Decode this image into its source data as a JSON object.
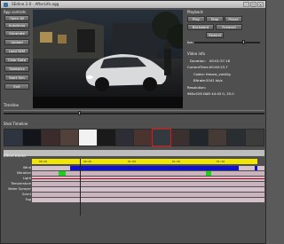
{
  "window": {
    "title": "SEdine 2.0 - AfterLife.ogg",
    "buttons": [
      "–",
      "□",
      "✕"
    ]
  },
  "app_controls": {
    "label": "App controls",
    "buttons": [
      "Open All",
      "AutoAnno",
      "Generate",
      "Upload",
      "Load SEM",
      "Clear Data",
      "Statistics",
      "Start Sim",
      "Exit"
    ]
  },
  "playback": {
    "label": "Playback",
    "row1": [
      "Play",
      "Stop",
      "Pause"
    ],
    "row2": [
      "Backward",
      "Forward"
    ],
    "row3": [
      "Rewind"
    ],
    "fps_label": "fps:"
  },
  "video_info": {
    "label": "Video info",
    "duration_label": "Duration:",
    "duration": "00:01:57.18",
    "current_label": "CurrentTime:",
    "current": "00:00:23.7",
    "codec_label": "Codec:",
    "codec": "theora_vorb2g",
    "bitrate_label": "Bitrate:",
    "bitrate": "2041 kb/s",
    "resolution_label": "Resolution:",
    "resolution": "960x528 DAR 44:45 0, 25.0"
  },
  "timeline_label": "Timeline",
  "shot_timeline_label": "Shot Timeline",
  "effect_tracks_label": "Effect tracks",
  "ruler_ticks": [
    "00:20",
    "00:40",
    "01:00",
    "01:20",
    "01:40"
  ],
  "tracks": [
    "Wind",
    "Vibration",
    "Light",
    "Temperature",
    "Water Sprayer",
    "Scent",
    "Fog"
  ],
  "colors": {
    "ruler": "#f0e600",
    "wind_effect": "#1010d0",
    "vibration_effect": "#1cd21c",
    "light_effect": "#b00020",
    "track_bg": "#d4c0c8"
  }
}
